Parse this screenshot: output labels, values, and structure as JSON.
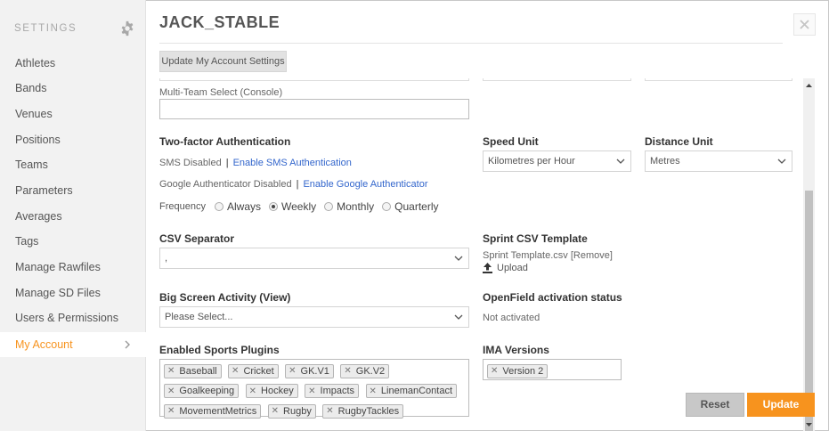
{
  "sidebar": {
    "title": "SETTINGS",
    "items": [
      {
        "label": "Athletes"
      },
      {
        "label": "Bands"
      },
      {
        "label": "Venues"
      },
      {
        "label": "Positions"
      },
      {
        "label": "Teams"
      },
      {
        "label": "Parameters"
      },
      {
        "label": "Averages"
      },
      {
        "label": "Tags"
      },
      {
        "label": "Manage Rawfiles"
      },
      {
        "label": "Manage SD Files"
      },
      {
        "label": "Users & Permissions"
      },
      {
        "label": "My Account",
        "active": true
      }
    ]
  },
  "header": {
    "title": "JACK_STABLE",
    "update_account_label": "Update My Account Settings"
  },
  "form": {
    "multi_team": {
      "label": "Multi-Team Select (Console)",
      "value": ""
    },
    "two_factor": {
      "label": "Two-factor Authentication",
      "sms_status": "SMS Disabled",
      "sms_link": "Enable SMS Authentication",
      "google_status": "Google Authenticator Disabled",
      "google_link": "Enable Google Authenticator",
      "frequency_label": "Frequency",
      "options": [
        "Always",
        "Weekly",
        "Monthly",
        "Quarterly"
      ],
      "selected": "Weekly"
    },
    "speed_unit": {
      "label": "Speed Unit",
      "value": "Kilometres per Hour"
    },
    "distance_unit": {
      "label": "Distance Unit",
      "value": "Metres"
    },
    "csv_separator": {
      "label": "CSV Separator",
      "value": ","
    },
    "sprint_csv": {
      "label": "Sprint CSV Template",
      "filename": "Sprint Template.csv",
      "remove": "[Remove]",
      "upload": "Upload"
    },
    "big_screen": {
      "label": "Big Screen Activity",
      "view_link": "(View)",
      "value": "Please Select..."
    },
    "openfield": {
      "label": "OpenField activation status",
      "value": "Not activated"
    },
    "sports_plugins": {
      "label": "Enabled Sports Plugins",
      "tags": [
        "Baseball",
        "Cricket",
        "GK.V1",
        "GK.V2",
        "Goalkeeping",
        "Hockey",
        "Impacts",
        "LinemanContact",
        "MovementMetrics",
        "Rugby",
        "RugbyTackles"
      ]
    },
    "ima_versions": {
      "label": "IMA Versions",
      "tags": [
        "Version 2"
      ]
    }
  },
  "actions": {
    "reset": "Reset",
    "update": "Update"
  },
  "colors": {
    "accent": "#f7931e",
    "link": "#3366cc"
  }
}
